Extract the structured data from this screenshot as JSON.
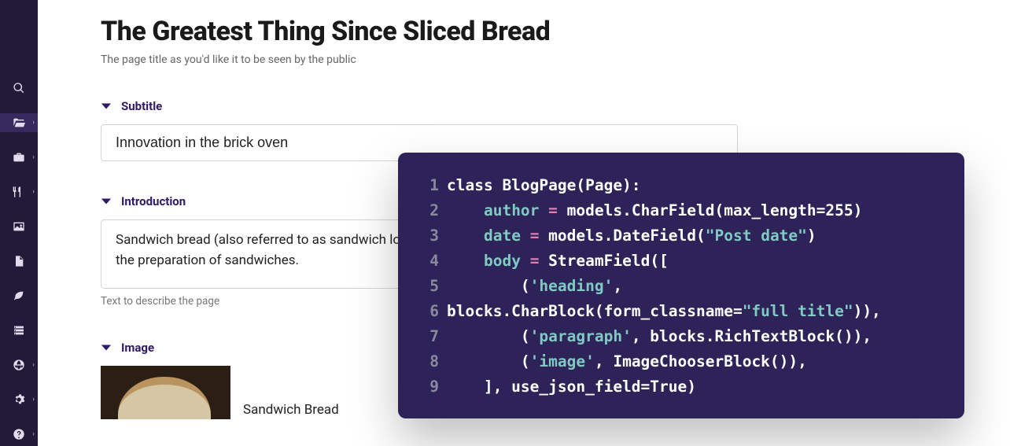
{
  "page": {
    "title": "The Greatest Thing Since Sliced Bread",
    "title_help": "The page title as you'd like it to be seen by the public"
  },
  "fields": {
    "subtitle": {
      "label": "Subtitle",
      "value": "Innovation in the brick oven"
    },
    "introduction": {
      "label": "Introduction",
      "value": "Sandwich bread (also referred to as sandwich loaf) is bread that is prepared specifically to be used for the preparation of sandwiches.",
      "help": "Text to describe the page"
    },
    "image": {
      "label": "Image",
      "caption": "Sandwich Bread"
    }
  },
  "sidebar": {
    "icons": [
      {
        "name": "search-icon",
        "chevron": false
      },
      {
        "name": "folder-open-icon",
        "chevron": true,
        "active": true
      },
      {
        "name": "briefcase-icon",
        "chevron": true
      },
      {
        "name": "utensils-icon",
        "chevron": true
      },
      {
        "name": "image-icon",
        "chevron": false
      },
      {
        "name": "document-icon",
        "chevron": false
      },
      {
        "name": "leaf-icon",
        "chevron": false
      },
      {
        "name": "storage-icon",
        "chevron": false
      },
      {
        "name": "globe-icon",
        "chevron": true
      },
      {
        "name": "settings-icon",
        "chevron": true
      },
      {
        "name": "help-icon",
        "chevron": true
      }
    ]
  },
  "code": [
    [
      {
        "t": "class BlogPage(Page):",
        "c": ""
      }
    ],
    [
      {
        "t": "    ",
        "c": ""
      },
      {
        "t": "author",
        "c": "tk-id"
      },
      {
        "t": " ",
        "c": ""
      },
      {
        "t": "=",
        "c": "tk-eq"
      },
      {
        "t": " models.CharField(max_length=255)",
        "c": ""
      }
    ],
    [
      {
        "t": "    ",
        "c": ""
      },
      {
        "t": "date",
        "c": "tk-id"
      },
      {
        "t": " ",
        "c": ""
      },
      {
        "t": "=",
        "c": "tk-eq"
      },
      {
        "t": " models.DateField(",
        "c": ""
      },
      {
        "t": "\"Post date\"",
        "c": "tk-str"
      },
      {
        "t": ")",
        "c": ""
      }
    ],
    [
      {
        "t": "    ",
        "c": ""
      },
      {
        "t": "body",
        "c": "tk-id"
      },
      {
        "t": " ",
        "c": ""
      },
      {
        "t": "=",
        "c": "tk-eq"
      },
      {
        "t": " StreamField([",
        "c": ""
      }
    ],
    [
      {
        "t": "        (",
        "c": ""
      },
      {
        "t": "'heading'",
        "c": "tk-str"
      },
      {
        "t": ",",
        "c": ""
      }
    ],
    [
      {
        "t": "blocks.CharBlock(form_classname=",
        "c": ""
      },
      {
        "t": "\"full title\"",
        "c": "tk-str"
      },
      {
        "t": ")),",
        "c": ""
      }
    ],
    [
      {
        "t": "        (",
        "c": ""
      },
      {
        "t": "'paragraph'",
        "c": "tk-str"
      },
      {
        "t": ", blocks.RichTextBlock()),",
        "c": ""
      }
    ],
    [
      {
        "t": "        (",
        "c": ""
      },
      {
        "t": "'image'",
        "c": "tk-str"
      },
      {
        "t": ", ImageChooserBlock()),",
        "c": ""
      }
    ],
    [
      {
        "t": "    ], use_json_field=True)",
        "c": ""
      }
    ]
  ]
}
